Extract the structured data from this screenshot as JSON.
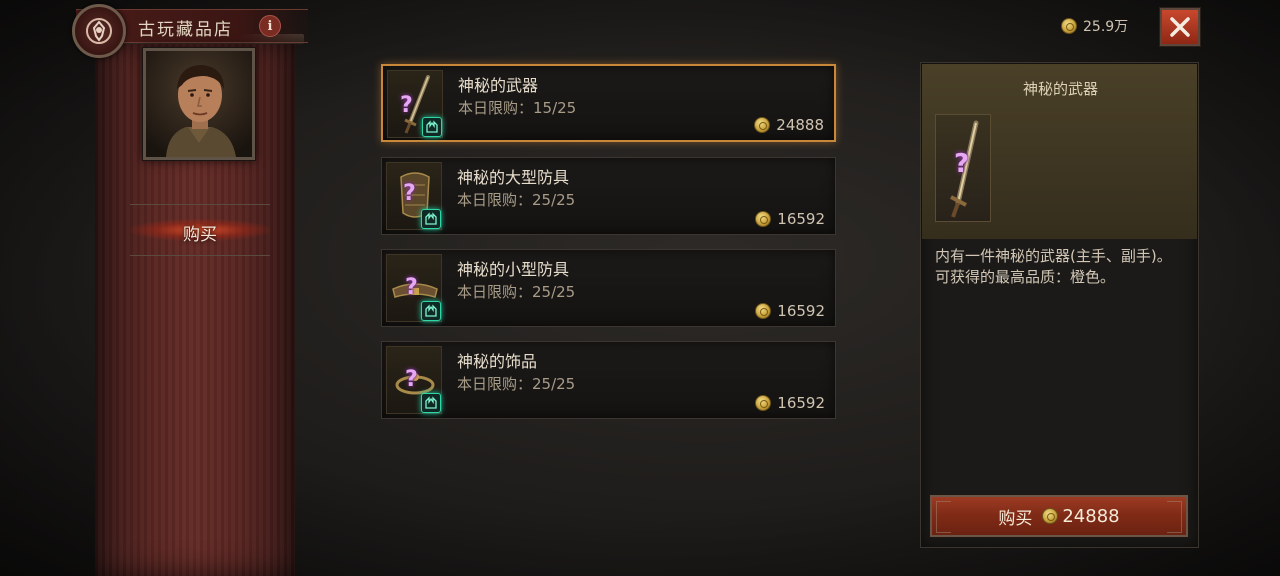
{
  "shop": {
    "title": "古玩藏品店",
    "info_glyph": "i",
    "tab_buy": "购买"
  },
  "currency": {
    "gold": "25.9万"
  },
  "items": [
    {
      "name": "神秘的武器",
      "limit": "本日限购：15/25",
      "price": "24888",
      "selected": true,
      "icon": "mystery-weapon-icon"
    },
    {
      "name": "神秘的大型防具",
      "limit": "本日限购：25/25",
      "price": "16592",
      "selected": false,
      "icon": "mystery-large-armor-icon"
    },
    {
      "name": "神秘的小型防具",
      "limit": "本日限购：25/25",
      "price": "16592",
      "selected": false,
      "icon": "mystery-small-armor-icon"
    },
    {
      "name": "神秘的饰品",
      "limit": "本日限购：25/25",
      "price": "16592",
      "selected": false,
      "icon": "mystery-jewelry-icon"
    }
  ],
  "detail": {
    "title": "神秘的武器",
    "desc_line1": "内有一件神秘的武器(主手、副手)。",
    "desc_line2": "可获得的最高品质：橙色。",
    "buy_label": "购买",
    "buy_price": "24888"
  },
  "colors": {
    "accent_gold": "#c9873a",
    "buy_red": "#8e2715",
    "ancient_teal": "#2fd6a8",
    "mystery_purple": "#e6a8f2"
  }
}
